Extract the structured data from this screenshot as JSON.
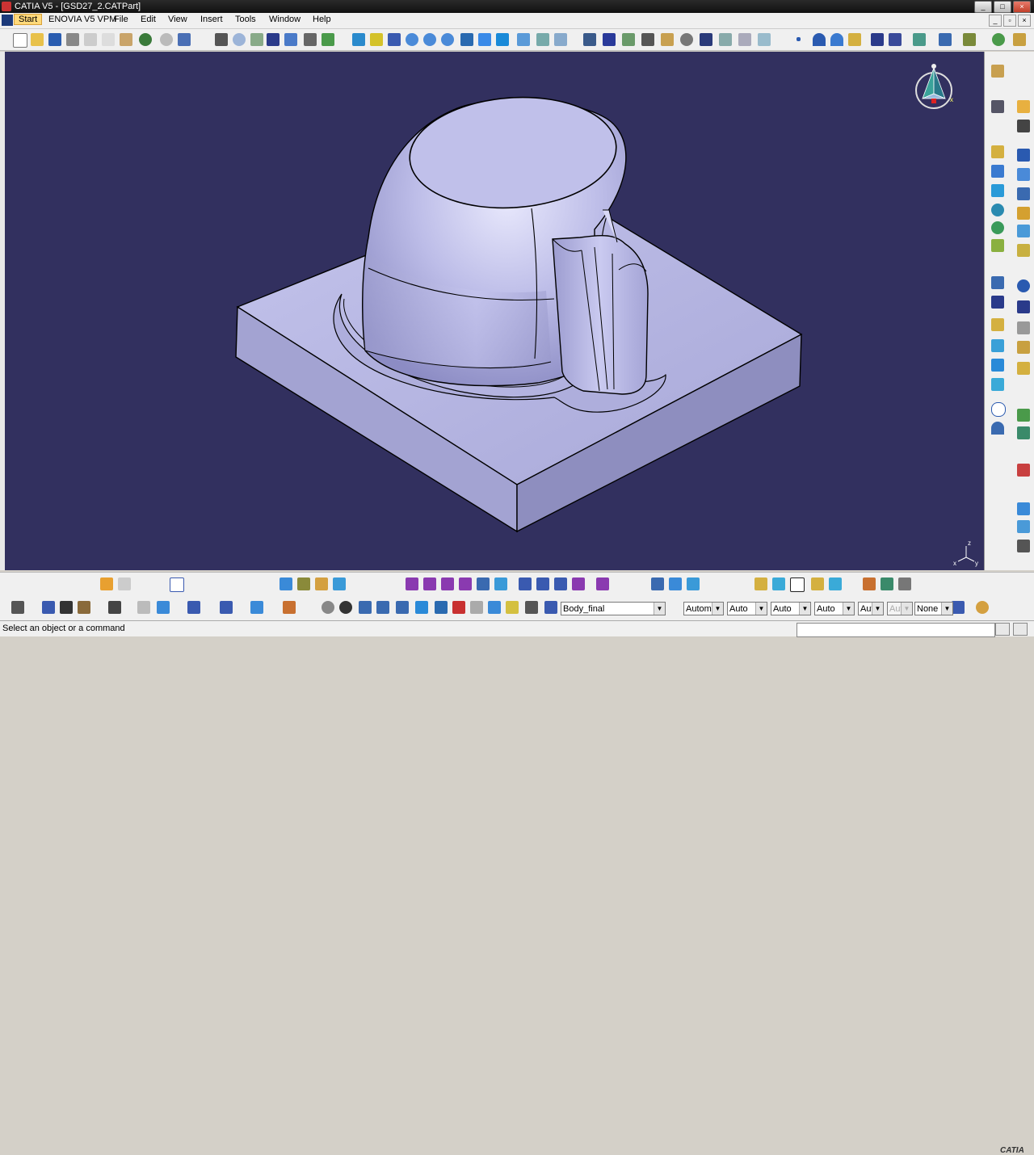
{
  "window": {
    "title": "CATIA V5 - [GSD27_2.CATPart]",
    "buttons": [
      "_",
      "□",
      "×"
    ]
  },
  "menubar": {
    "items": [
      "Start",
      "ENOVIA V5 VPM",
      "File",
      "Edit",
      "View",
      "Insert",
      "Tools",
      "Window",
      "Help"
    ],
    "mdi_buttons": [
      "_",
      "▫",
      "×"
    ]
  },
  "viewport": {
    "background_color": "#32305f",
    "part_color": "#b6b6e4",
    "compass_axes": [
      "x",
      "y",
      "z"
    ]
  },
  "toolbar_bottom": {
    "body_selector": "Body_final",
    "combos": [
      "Autom.",
      "Auto",
      "Auto",
      "Auto",
      "Aut",
      "Aut",
      "None"
    ]
  },
  "logo": "CATIA",
  "statusbar": {
    "message": "Select an object or a command",
    "command_input": ""
  }
}
